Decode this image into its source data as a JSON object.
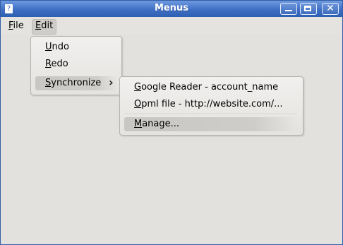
{
  "window": {
    "title": "Menus",
    "app_icon_glyph": "?",
    "controls": {
      "minimize": "minimize-icon",
      "maximize": "maximize-icon",
      "close": "close-icon",
      "close_glyph": "✕"
    }
  },
  "menubar": {
    "items": [
      {
        "label_access": "F",
        "label_rest": "ile"
      },
      {
        "label_access": "E",
        "label_rest": "dit"
      }
    ]
  },
  "edit_menu": {
    "items": [
      {
        "label_access": "U",
        "label_rest": "ndo"
      },
      {
        "label_access": "R",
        "label_rest": "edo"
      },
      {
        "label_access": "S",
        "label_rest": "ynchronize",
        "submenu_arrow": "›"
      }
    ]
  },
  "sync_menu": {
    "items": [
      {
        "label_access": "G",
        "label_rest": "oogle Reader - account_name"
      },
      {
        "label_access": "O",
        "label_rest": "pml file - http://website.com/..."
      },
      {
        "label_access": "M",
        "label_rest": "anage..."
      }
    ]
  },
  "colors": {
    "titlebar": "#3f6fc4",
    "highlight": "#cfcdc9",
    "window_bg": "#e2e1de"
  }
}
